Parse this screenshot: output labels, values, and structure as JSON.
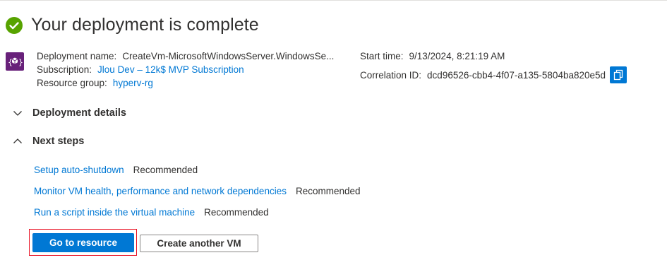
{
  "header": {
    "title": "Your deployment is complete",
    "status_icon": "checkmark-circle-icon",
    "status_color": "#57a300"
  },
  "deployment": {
    "icon": "deployment-cube-icon",
    "icon_color": "#68217a",
    "name_label": "Deployment name:",
    "name_value": "CreateVm-MicrosoftWindowsServer.WindowsSe...",
    "subscription_label": "Subscription:",
    "subscription_value": "Jlou Dev – 12k$ MVP Subscription",
    "resource_group_label": "Resource group:",
    "resource_group_value": "hyperv-rg",
    "start_time_label": "Start time:",
    "start_time_value": "9/13/2024, 8:21:19 AM",
    "correlation_label": "Correlation ID:",
    "correlation_value": "dcd96526-cbb4-4f07-a135-5804ba820e5d",
    "copy_icon": "copy-icon"
  },
  "sections": {
    "details": {
      "label": "Deployment details",
      "expanded": false
    },
    "next_steps": {
      "label": "Next steps",
      "expanded": true,
      "items": [
        {
          "link": "Setup auto-shutdown",
          "tag": "Recommended"
        },
        {
          "link": "Monitor VM health, performance and network dependencies",
          "tag": "Recommended"
        },
        {
          "link": "Run a script inside the virtual machine",
          "tag": "Recommended"
        }
      ]
    }
  },
  "actions": {
    "primary_label": "Go to resource",
    "secondary_label": "Create another VM"
  },
  "colors": {
    "accent": "#0078d4",
    "focus_outline": "#e81123",
    "text": "#323130"
  }
}
